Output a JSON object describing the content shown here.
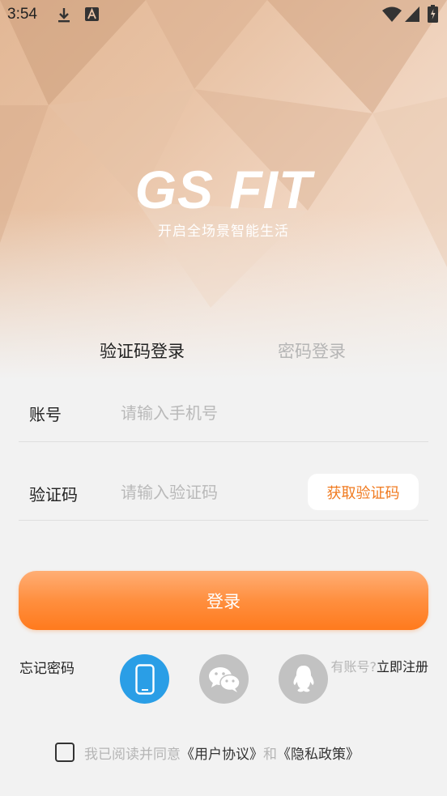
{
  "status_bar": {
    "time": "3:54",
    "left_icons": [
      "download-icon",
      "text-a-icon"
    ],
    "right_icons": [
      "wifi-icon",
      "signal-icon",
      "battery-icon"
    ]
  },
  "brand": {
    "logo_text": "GS FIT",
    "slogan": "开启全场景智能生活"
  },
  "tabs": [
    {
      "label": "验证码登录",
      "active": true
    },
    {
      "label": "密码登录",
      "active": false
    }
  ],
  "form": {
    "account_label": "账号",
    "account_placeholder": "请输入手机号",
    "account_value": "",
    "code_label": "验证码",
    "code_placeholder": "请输入验证码",
    "code_value": "",
    "get_code_button": "获取验证码"
  },
  "login_button": "登录",
  "forgot_password": "忘记密码",
  "register": {
    "prefix_visible": "有账号?",
    "link": "立即注册"
  },
  "social_logins": [
    {
      "icon": "phone-icon",
      "color": "#2a9ee6"
    },
    {
      "icon": "wechat-icon",
      "color": "#c2c2c2"
    },
    {
      "icon": "qq-icon",
      "color": "#c2c2c2"
    }
  ],
  "agreement": {
    "prefix": "我已阅读并同意",
    "user_agreement": "《用户协议》",
    "conjunction": "和",
    "privacy_policy": "《隐私政策》",
    "checked": false
  },
  "colors": {
    "accent": "#ff7a1d",
    "accent_text": "#f07a1f",
    "active_social": "#2a9ee6",
    "inactive_social": "#c2c2c2",
    "background": "#f2f2f2"
  }
}
